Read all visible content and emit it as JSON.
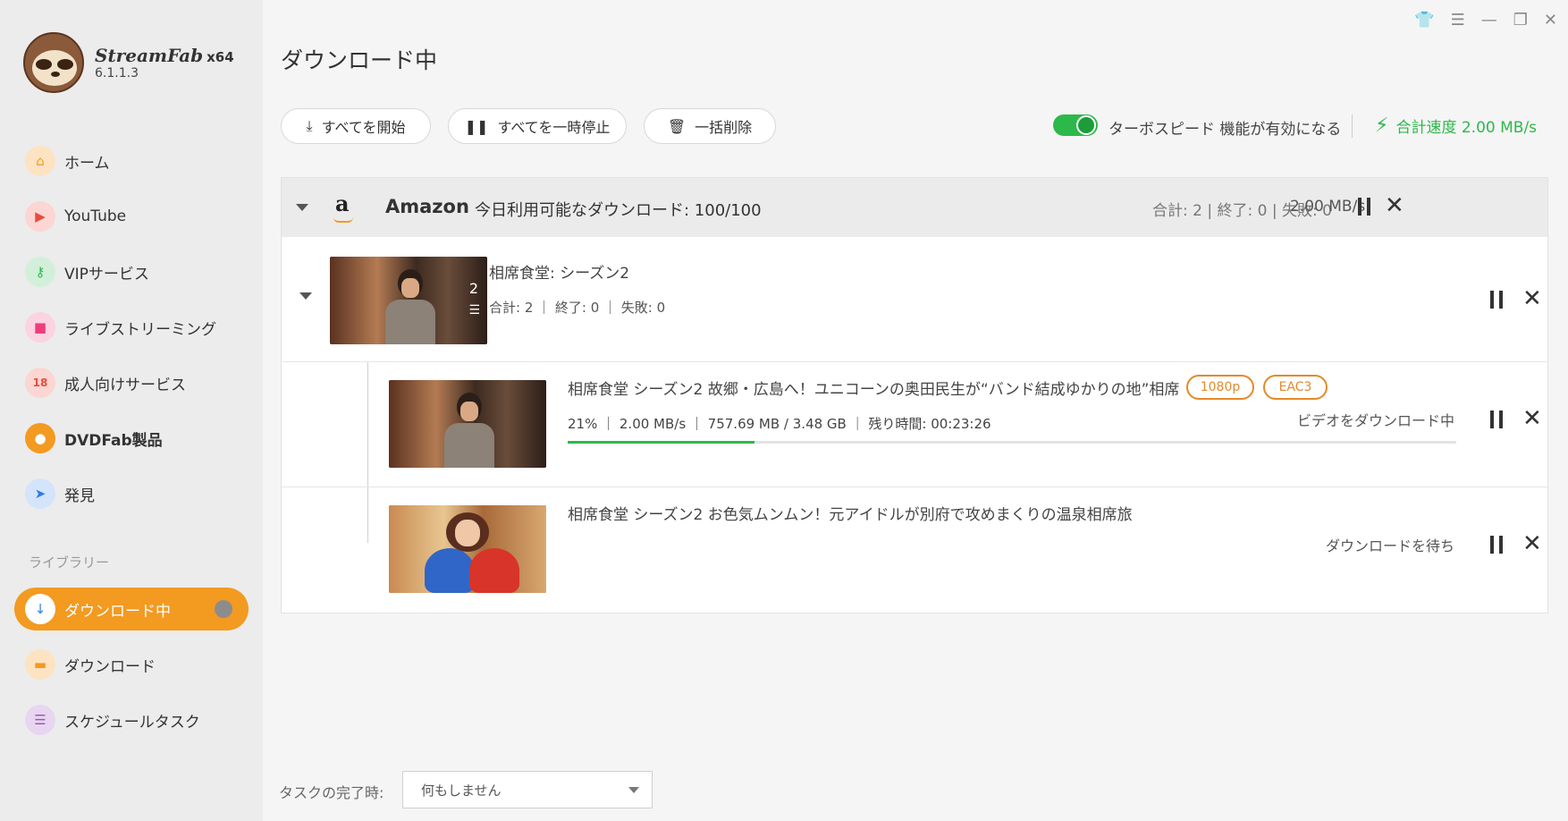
{
  "app": {
    "name": "StreamFab",
    "arch": "x64",
    "version": "6.1.1.3"
  },
  "sidebar": {
    "items": [
      {
        "label": "ホーム",
        "icon": "home-icon",
        "color": "#f39a21"
      },
      {
        "label": "YouTube",
        "icon": "youtube-icon",
        "color": "#e74c3c"
      },
      {
        "label": "VIPサービス",
        "icon": "key-icon",
        "color": "#2db84b"
      },
      {
        "label": "ライブストリーミング",
        "icon": "camera-icon",
        "color": "#ec407a"
      },
      {
        "label": "成人向けサービス",
        "icon": "adult-18-icon",
        "color": "#e74c3c"
      },
      {
        "label": "DVDFab製品",
        "icon": "dvdfab-icon",
        "color": "#2b7de9"
      },
      {
        "label": "発見",
        "icon": "compass-icon",
        "color": "#2b7de9"
      }
    ],
    "library_label": "ライブラリー",
    "library": [
      {
        "label": "ダウンロード中",
        "icon": "download-icon",
        "active": true
      },
      {
        "label": "ダウンロード",
        "icon": "folder-icon",
        "color": "#f39a21"
      },
      {
        "label": "スケジュールタスク",
        "icon": "schedule-icon",
        "color": "#9b59b6"
      }
    ]
  },
  "main": {
    "title": "ダウンロード中",
    "toolbar": {
      "start_all": "すべてを開始",
      "pause_all": "すべてを一時停止",
      "delete_all": "一括削除"
    },
    "turbo": {
      "label": "ターボスピード 機能が有効になる",
      "enabled": true
    },
    "total_speed": "合計速度 2.00 MB/s",
    "group": {
      "service": "Amazon",
      "availability": "今日利用可能なダウンロード: 100/100",
      "stats": "合計: 2 | 終了: 0 | 失敗: 0",
      "speed": "2.00 MB/s",
      "season": {
        "title": "相席食堂: シーズン2",
        "count": "2",
        "stats": "合計: 2 ｜ 終了: 0 ｜ 失敗: 0"
      },
      "episodes": [
        {
          "title": "相席食堂 シーズン2 故郷・広島へ！ユニコーンの奥田民生が“バンド結成ゆかりの地”相席",
          "badges": [
            "1080p",
            "EAC3"
          ],
          "stats": "21% ｜ 2.00 MB/s ｜ 757.69 MB / 3.48 GB ｜ 残り時間: 00:23:26",
          "progress": 0.21,
          "status": "ビデオをダウンロード中"
        },
        {
          "title": "相席食堂 シーズン2 お色気ムンムン！元アイドルが別府で攻めまくりの温泉相席旅",
          "status": "ダウンロードを待ち"
        }
      ]
    },
    "footer": {
      "label": "タスクの完了時:",
      "select_value": "何もしません"
    }
  },
  "colors": {
    "accent": "#f39a21",
    "green": "#2db84b",
    "badge": "#e38a2a"
  }
}
